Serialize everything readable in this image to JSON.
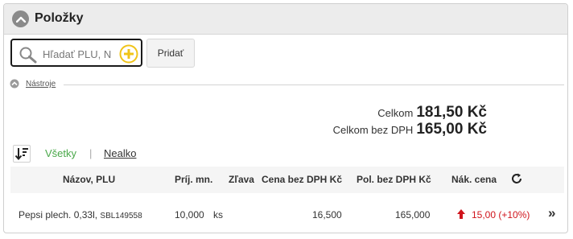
{
  "panel": {
    "title": "Položky"
  },
  "search": {
    "placeholder": "Hľadať PLU, N"
  },
  "toolbar": {
    "add_label": "Pridať"
  },
  "tools": {
    "label": "Nástroje"
  },
  "totals": {
    "total_label": "Celkom",
    "total_value": "181,50 Kč",
    "net_label": "Celkom bez DPH",
    "net_value": "165,00 Kč"
  },
  "filters": {
    "all_label": "Všetky",
    "separator": "|",
    "nonalc_label": "Nealko"
  },
  "table": {
    "headers": {
      "name": "Názov, PLU",
      "qty": "Príj. mn.",
      "discount": "Zľava",
      "price_net": "Cena bez DPH Kč",
      "line_net": "Pol. bez DPH Kč",
      "purchase_price": "Nák. cena"
    },
    "rows": [
      {
        "name": "Pepsi plech. 0,33l,",
        "plu": "SBL149558",
        "qty": "10,000",
        "unit": "ks",
        "price_net": "16,500",
        "line_net": "165,000",
        "purchase_price": "15,00 (+10%)"
      }
    ]
  },
  "colors": {
    "accent_green": "#4aa84a",
    "price_up_red": "#d0141c",
    "add_icon_yellow": "#f0c419"
  }
}
